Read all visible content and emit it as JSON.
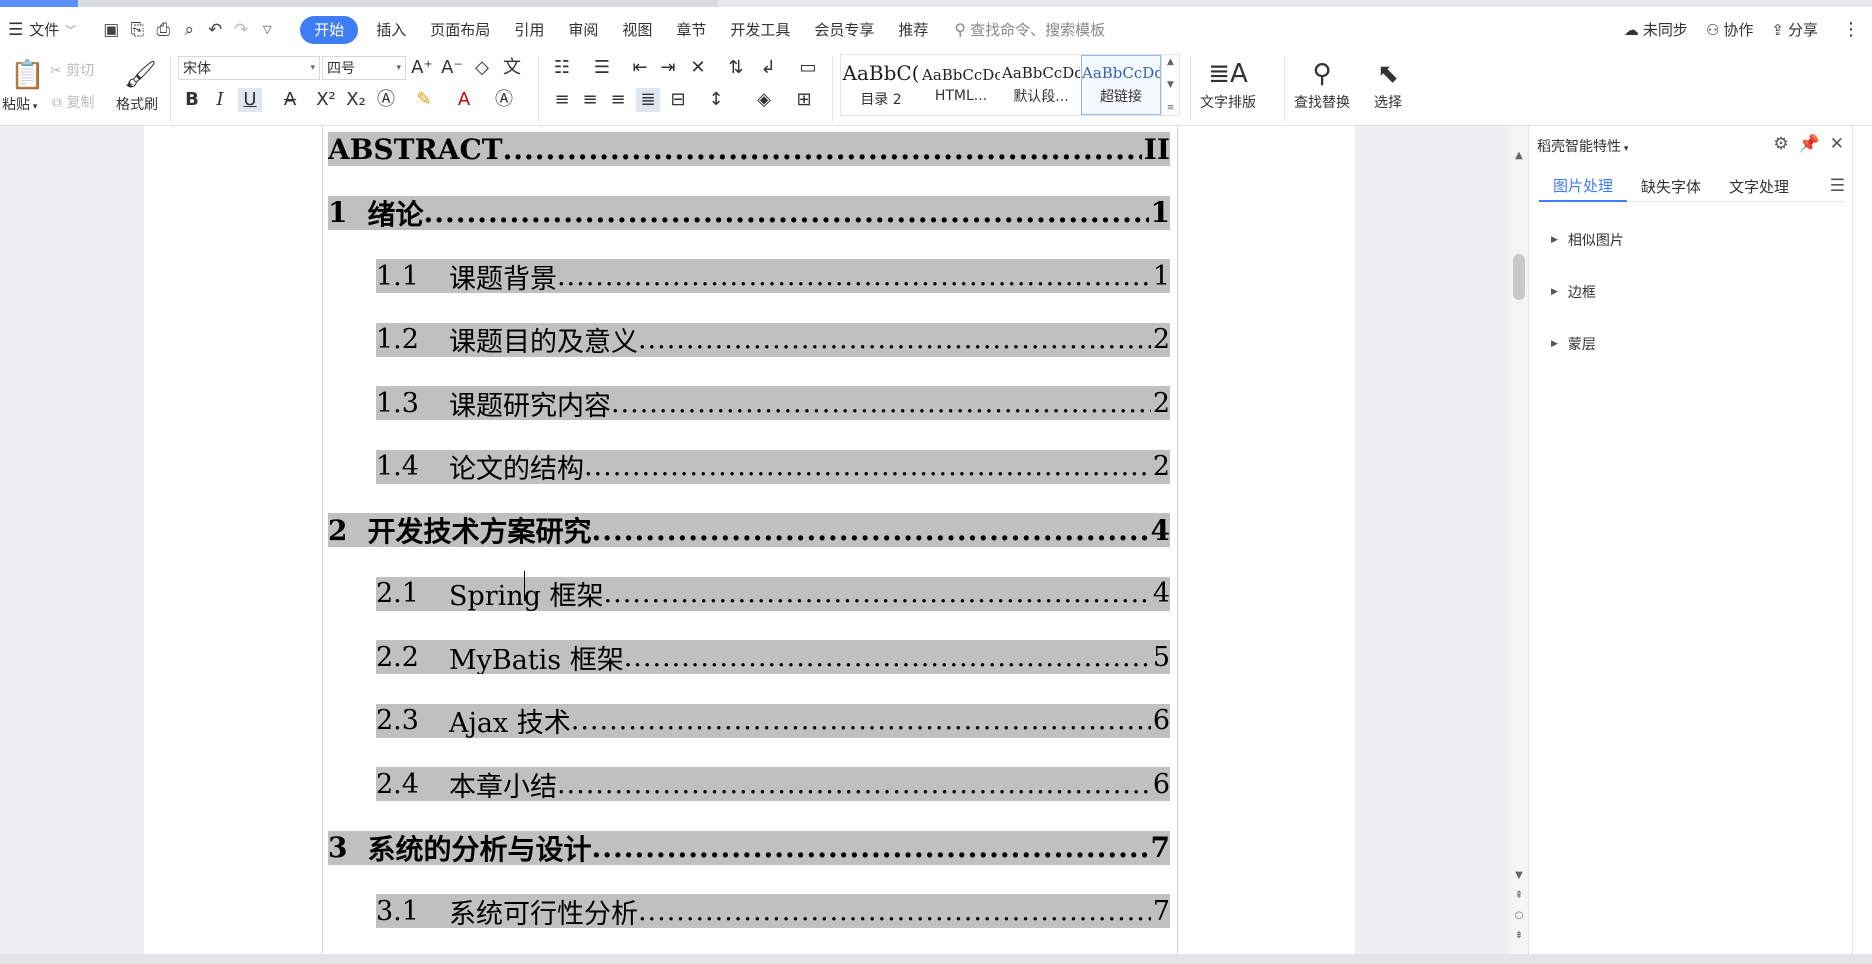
{
  "menubar": {
    "file": "文件",
    "tabs": [
      "开始",
      "插入",
      "页面布局",
      "引用",
      "审阅",
      "视图",
      "章节",
      "开发工具",
      "会员专享",
      "推荐"
    ],
    "active_tab": "开始",
    "search_placeholder": "查找命令、搜索模板",
    "right": {
      "sync": "未同步",
      "collab": "协作",
      "share": "分享"
    }
  },
  "ribbon": {
    "paste": "粘贴",
    "cut": "剪切",
    "copy": "复制",
    "format_painter": "格式刷",
    "font_name": "宋体",
    "font_size": "四号",
    "styles": [
      {
        "preview": "AaBbC(",
        "name": "目录 2"
      },
      {
        "preview": "AaBbCcDc",
        "name": "HTML..."
      },
      {
        "preview": "AaBbCcDd",
        "name": "默认段..."
      },
      {
        "preview": "AaBbCcDd",
        "name": "超链接"
      }
    ],
    "text_layout": "文字排版",
    "find_replace": "查找替换",
    "select": "选择"
  },
  "document": {
    "toc": [
      {
        "level": 1,
        "num": "",
        "title": "ABSTRACT",
        "page": "II"
      },
      {
        "level": 1,
        "num": "1",
        "title": "绪论",
        "page": "1"
      },
      {
        "level": 2,
        "num": "1.1",
        "title": "课题背景",
        "page": "1"
      },
      {
        "level": 2,
        "num": "1.2",
        "title": "课题目的及意义",
        "page": "2"
      },
      {
        "level": 2,
        "num": "1.3",
        "title": "课题研究内容",
        "page": "2"
      },
      {
        "level": 2,
        "num": "1.4",
        "title": "论文的结构",
        "page": "2"
      },
      {
        "level": 1,
        "num": "2",
        "title": "开发技术方案研究",
        "page": "4"
      },
      {
        "level": 2,
        "num": "2.1",
        "title": "Spring 框架",
        "page": "4"
      },
      {
        "level": 2,
        "num": "2.2",
        "title": "MyBatis 框架",
        "page": "5"
      },
      {
        "level": 2,
        "num": "2.3",
        "title": "Ajax 技术",
        "page": "6"
      },
      {
        "level": 2,
        "num": "2.4",
        "title": "本章小结",
        "page": "6"
      },
      {
        "level": 1,
        "num": "3",
        "title": "系统的分析与设计",
        "page": "7"
      },
      {
        "level": 2,
        "num": "3.1",
        "title": "系统可行性分析",
        "page": "7"
      }
    ]
  },
  "pane": {
    "title": "稻壳智能特性",
    "tabs": [
      "图片处理",
      "缺失字体",
      "文字处理"
    ],
    "active_tab": "图片处理",
    "sections": [
      "相似图片",
      "边框",
      "蒙层"
    ]
  }
}
